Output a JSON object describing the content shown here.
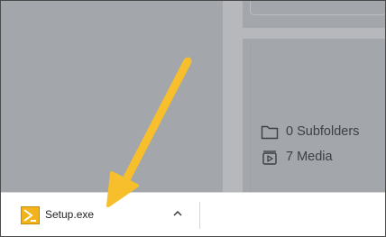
{
  "stats": {
    "subfolders": "0 Subfolders",
    "media": "7 Media"
  },
  "download": {
    "file_name": "Setup.exe"
  },
  "icons": {
    "folder": "folder-icon",
    "media": "media-icon",
    "file": "setup-file-icon",
    "chevron": "chevron-up-icon",
    "arrow": "annotation-arrow"
  },
  "colors": {
    "arrow": "#f6bf2b",
    "file_icon": "#f2b31b",
    "overlay": "#a3a6aa"
  }
}
